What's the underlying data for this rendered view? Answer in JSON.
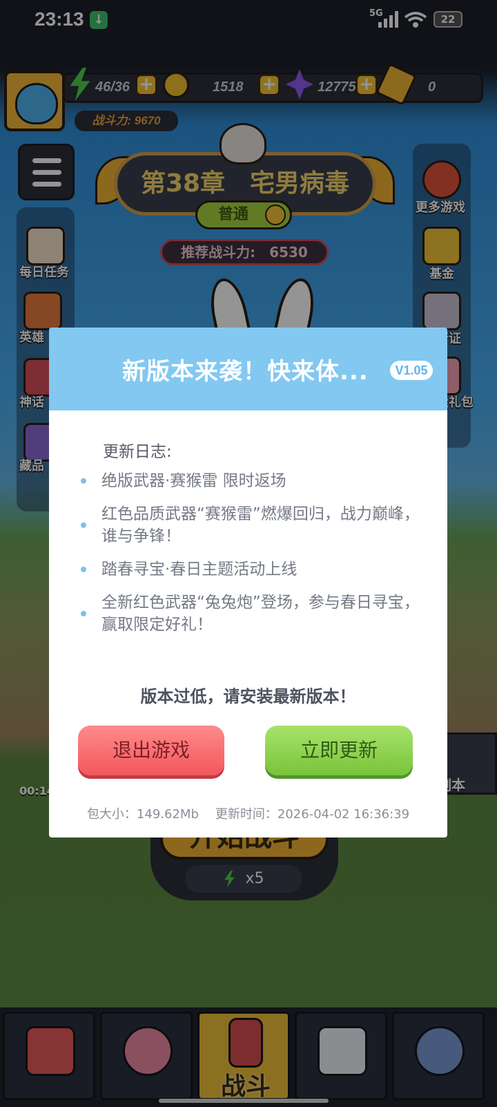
{
  "status_bar": {
    "time": "23:13",
    "network": "5G",
    "battery": "22"
  },
  "hud": {
    "energy": "46/36",
    "coins": "1518",
    "gems": "12775",
    "tickets": "0",
    "combat_power": "战斗力: 9670"
  },
  "stage": {
    "chapter_title": "第38章　宅男病毒",
    "difficulty": "普通",
    "recommended_power": "推荐战斗力:　6530"
  },
  "left_menu": [
    "每日任务",
    "英雄",
    "神话",
    "藏品"
  ],
  "right_menu": [
    "更多游戏",
    "基金",
    "行证",
    "大礼包"
  ],
  "event_timer": "00:14",
  "right_side_label": "副本",
  "start_button": {
    "label": "开始战斗",
    "cost": "x5"
  },
  "bottom_nav": {
    "active_label": "战斗"
  },
  "dialog": {
    "title": "新版本来袭！快来体...",
    "version": "V1.05",
    "log_heading": "更新日志:",
    "log_items": [
      "绝版武器·赛猴雷 限时返场",
      "红色品质武器“赛猴雷”燃爆回归，战力巅峰，谁与争锋！",
      "踏春寻宝·春日主题活动上线",
      "全新红色武器“兔兔炮”登场，参与春日寻宝，赢取限定好礼！"
    ],
    "warning": "版本过低，请安装最新版本！",
    "exit_button": "退出游戏",
    "update_button": "立即更新",
    "package_size": "包大小：149.62Mb",
    "update_time": "更新时间：2026-04-02 16:36:39"
  },
  "colors": {
    "dialog_header": "#82c8f1",
    "exit_red": "#f2575d",
    "update_green": "#79c43a",
    "overlay": "rgba(0,0,0,0.42)"
  }
}
